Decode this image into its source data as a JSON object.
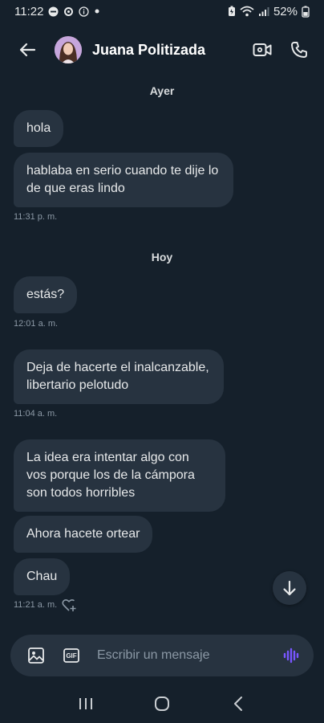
{
  "status_bar": {
    "time": "11:22",
    "battery": "52%",
    "icons": [
      "minus-circle-icon",
      "settings-icon",
      "info-icon",
      "dot-icon",
      "battery-saver-icon",
      "wifi-icon",
      "signal-icon"
    ]
  },
  "header": {
    "contact_name": "Juana Politizada",
    "back_icon": "arrow-left-icon",
    "video_icon": "video-call-icon",
    "phone_icon": "phone-icon"
  },
  "chat": {
    "day_yesterday": "Ayer",
    "day_today": "Hoy",
    "messages": [
      {
        "text": "hola"
      },
      {
        "text": "hablaba en serio cuando te dije lo de que eras lindo",
        "time": "11:31 p. m."
      },
      {
        "text": "estás?",
        "time": "12:01 a. m."
      },
      {
        "text": "Deja de hacerte el inalcanzable, libertario pelotudo",
        "time": "11:04 a. m."
      },
      {
        "text": "La idea era intentar algo con vos porque los de la cámpora son todos horribles"
      },
      {
        "text": "Ahora hacete ortear"
      },
      {
        "text": "Chau",
        "time": "11:21 a. m."
      }
    ]
  },
  "composer": {
    "placeholder": "Escribir un mensaje",
    "gif_label": "GIF"
  },
  "colors": {
    "background": "#15202b",
    "bubble": "#273340",
    "accent_voice": "#7856ff",
    "muted": "#8b98a5"
  }
}
